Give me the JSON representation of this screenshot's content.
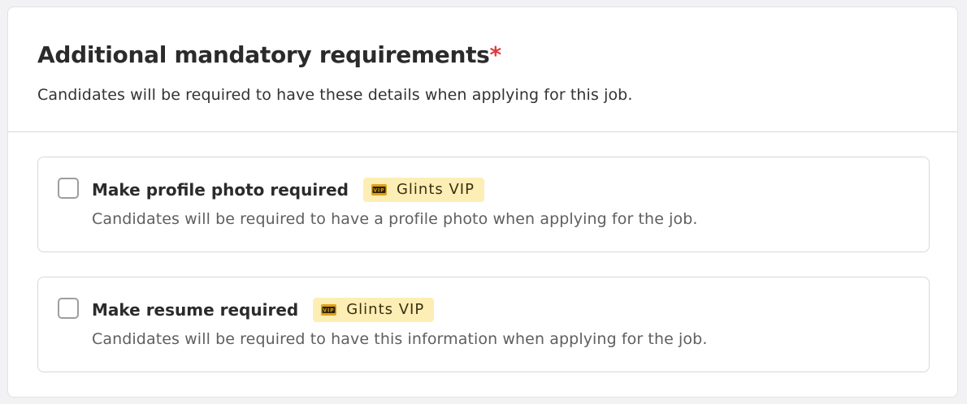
{
  "section": {
    "title": "Additional mandatory requirements",
    "required_marker": "*",
    "subtitle": "Candidates will be required to have these details when applying for this job."
  },
  "options": [
    {
      "title": "Make profile photo required",
      "badge_label": "Glints VIP",
      "badge_icon": "vip-icon",
      "description": "Candidates will be required to have a profile photo when applying for the job.",
      "checked": false
    },
    {
      "title": "Make resume required",
      "badge_label": "Glints VIP",
      "badge_icon": "vip-icon",
      "description": "Candidates will be required to have this information when applying for the job.",
      "checked": false
    }
  ],
  "colors": {
    "required_marker": "#e23b3b",
    "badge_background": "#fdeeb5",
    "vip_icon": "#e0a21a"
  }
}
